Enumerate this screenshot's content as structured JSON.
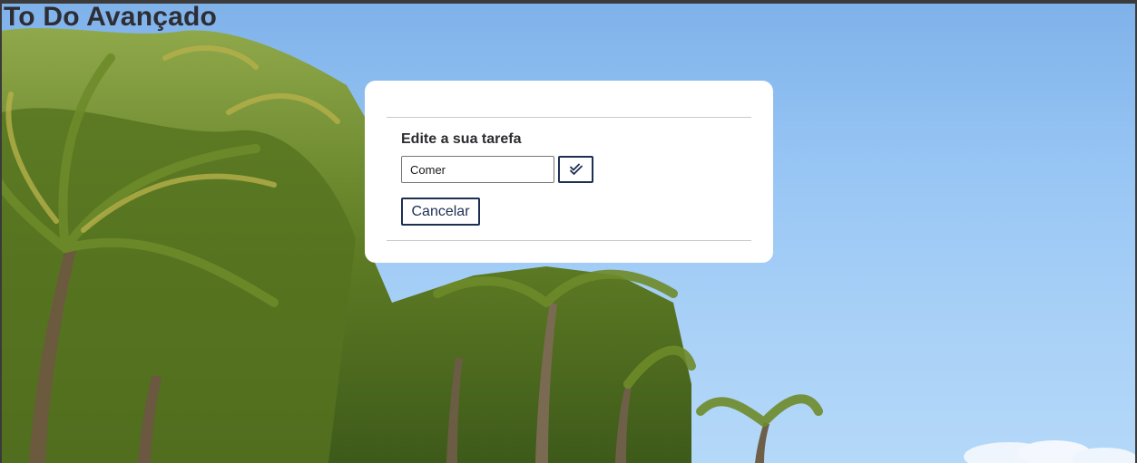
{
  "app": {
    "title": "To Do Avançado"
  },
  "edit_modal": {
    "heading": "Edite a sua tarefa",
    "task_input_value": "Comer",
    "confirm_icon": "double-check-icon",
    "cancel_label": "Cancelar"
  },
  "colors": {
    "accent": "#1d2f52",
    "sky": "#97c5f4",
    "palm_green": "#7a9a2e"
  }
}
